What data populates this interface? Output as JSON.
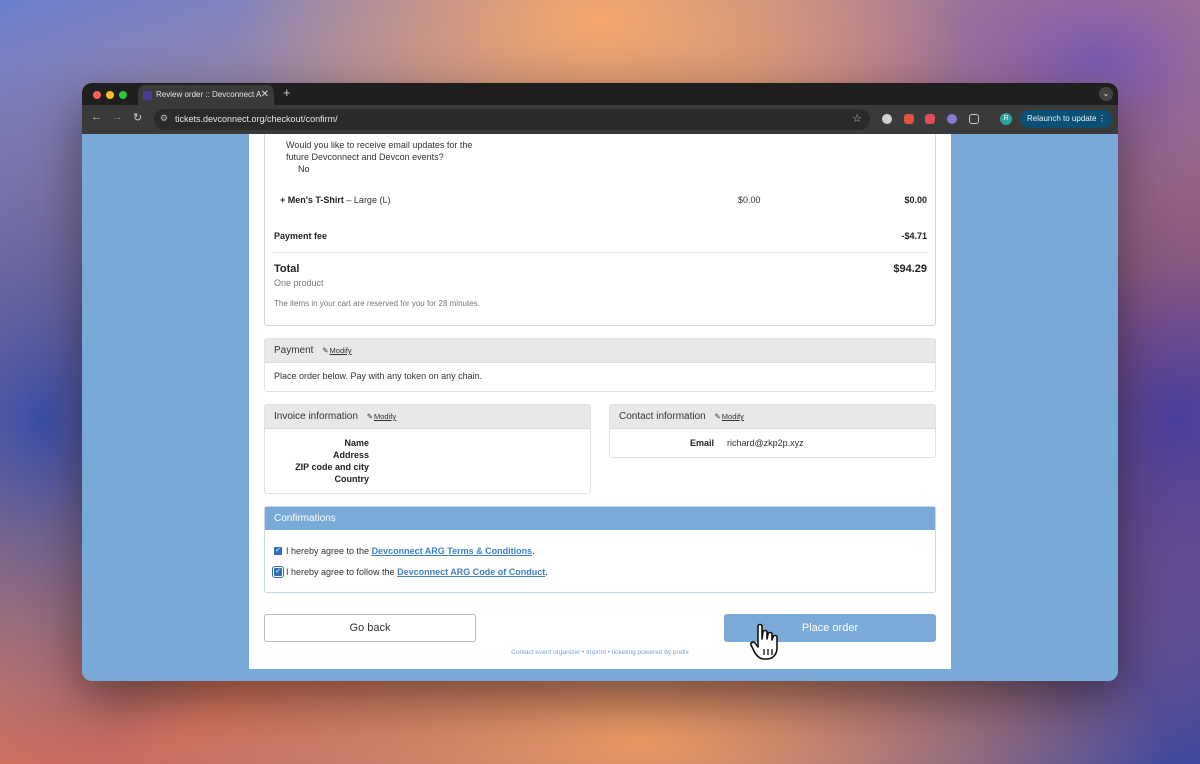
{
  "browser": {
    "tab_title": "Review order :: Devconnect A",
    "new_tab": "+",
    "url": "tickets.devconnect.org/checkout/confirm/",
    "profile_initial": "R",
    "relaunch_label": "Relaunch to update"
  },
  "cart": {
    "question_line1": "Would you like to receive email updates for the",
    "question_line2": "future Devconnect and Devcon events?",
    "question_answer": "No",
    "addon_name": "+ Men's T-Shirt",
    "addon_variant": "– Large (L)",
    "addon_price": "$0.00",
    "addon_total": "$0.00",
    "fee_label": "Payment fee",
    "fee_value": "-$4.71",
    "total_label": "Total",
    "total_value": "$94.29",
    "product_count": "One product",
    "reserved_note": "The items in your cart are reserved for you for 28 minutes."
  },
  "payment": {
    "title": "Payment",
    "modify": "Modify",
    "text": "Place order below. Pay with any token on any chain."
  },
  "invoice": {
    "title": "Invoice information",
    "modify": "Modify",
    "fields": [
      "Name",
      "Address",
      "ZIP code and city",
      "Country"
    ]
  },
  "contact": {
    "title": "Contact information",
    "modify": "Modify",
    "email_label": "Email",
    "email_value": "richard@zkp2p.xyz"
  },
  "confirmations": {
    "title": "Confirmations",
    "terms_prefix": "I hereby agree to the",
    "terms_link": "Devconnect ARG Terms & Conditions",
    "coc_prefix": "I hereby agree to follow the",
    "coc_link": "Devconnect ARG Code of Conduct",
    "period": "."
  },
  "actions": {
    "back": "Go back",
    "place": "Place order"
  },
  "footer": {
    "contact": "Contact event organizer",
    "imprint": "Imprint",
    "powered": "ticketing powered by pretix",
    "sep": "•"
  },
  "colors": {
    "page_bg": "#79a9d6",
    "accent": "#7aabd8",
    "link": "#3f7fc0"
  }
}
